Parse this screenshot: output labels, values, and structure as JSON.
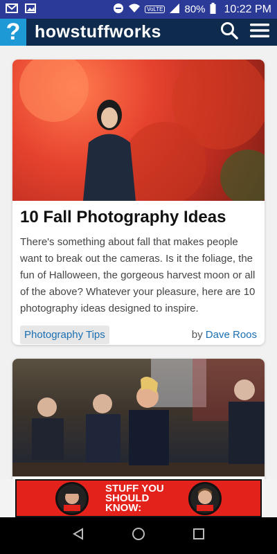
{
  "status_bar": {
    "battery": "80%",
    "time": "10:22 PM",
    "network_badge": "VoLTE"
  },
  "app_bar": {
    "logo_mark": "?",
    "logo_text": "howstuffworks"
  },
  "articles": [
    {
      "title": "10 Fall Photography Ideas",
      "description": "There's something about fall that makes people want to break out the cameras. Is it the foliage, the fun of Halloween, the gorgeous harvest moon or all of the above? Whatever your pleasure, here are 10 photography ideas designed to inspire.",
      "tag": "Photography Tips",
      "by_prefix": "by",
      "author": "Dave Roos"
    }
  ],
  "ad": {
    "text": "STUFF YOU SHOULD KNOW:"
  },
  "colors": {
    "status_bar": "#2b3a97",
    "app_bar": "#0e2a4d",
    "logo_accent": "#1d9ad6",
    "link": "#1a6fb3",
    "ad_red": "#e3221b"
  }
}
